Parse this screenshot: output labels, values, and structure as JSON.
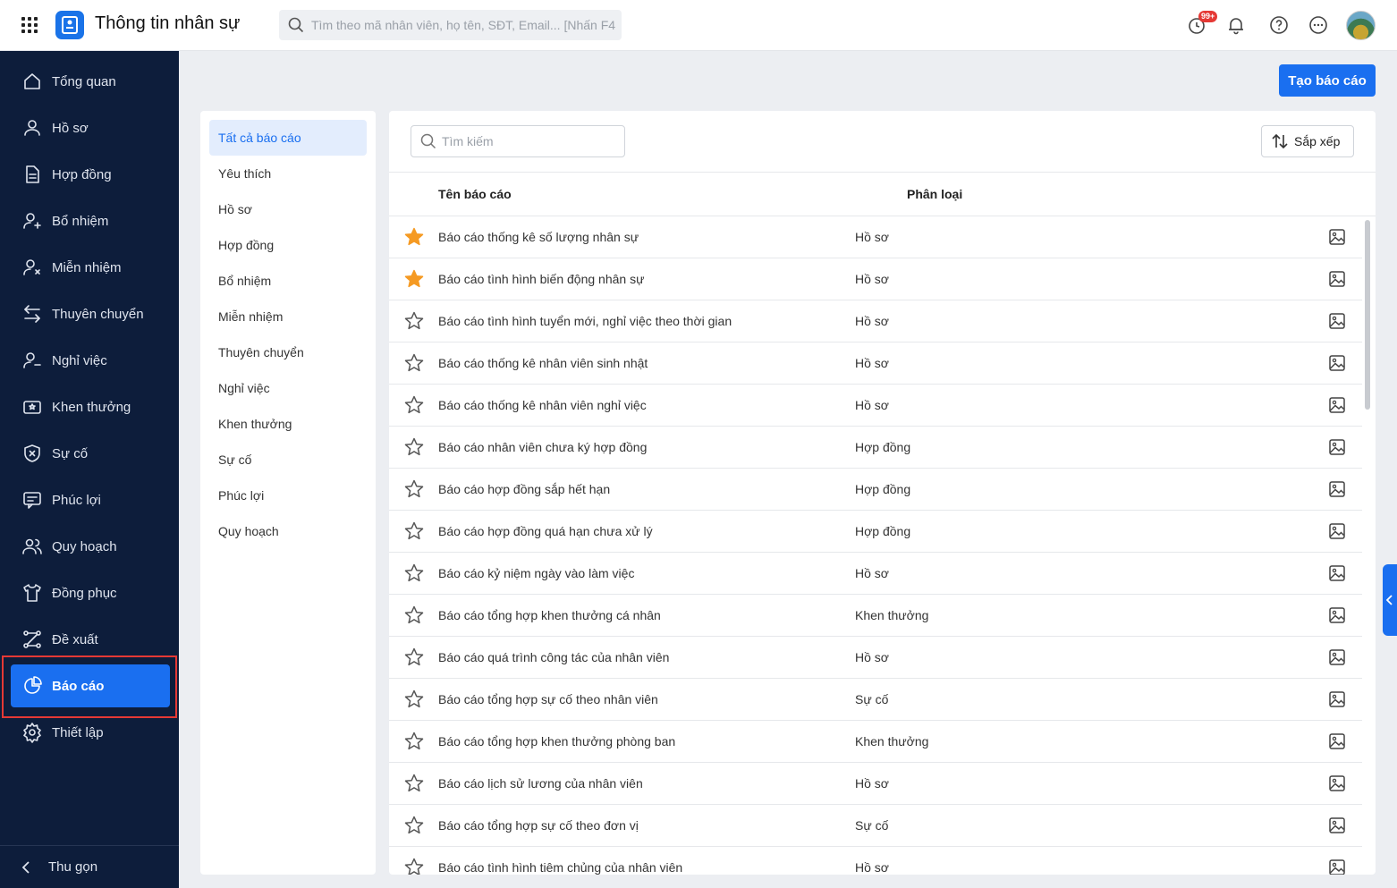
{
  "header": {
    "app_title": "Thông tin nhân sự",
    "search_placeholder": "Tìm theo mã nhân viên, họ tên, SĐT, Email... [Nhấn F4]",
    "notification_badge": "99+"
  },
  "sidebar": {
    "items": [
      {
        "label": "Tổng quan",
        "icon": "home-icon"
      },
      {
        "label": "Hồ sơ",
        "icon": "user-icon"
      },
      {
        "label": "Hợp đồng",
        "icon": "document-icon"
      },
      {
        "label": "Bổ nhiệm",
        "icon": "user-plus-icon"
      },
      {
        "label": "Miễn nhiệm",
        "icon": "user-x-icon"
      },
      {
        "label": "Thuyên chuyển",
        "icon": "transfer-icon"
      },
      {
        "label": "Nghỉ việc",
        "icon": "user-minus-icon"
      },
      {
        "label": "Khen thưởng",
        "icon": "reward-icon"
      },
      {
        "label": "Sự cố",
        "icon": "shield-x-icon"
      },
      {
        "label": "Phúc lợi",
        "icon": "benefit-icon"
      },
      {
        "label": "Quy hoạch",
        "icon": "users-icon"
      },
      {
        "label": "Đồng phục",
        "icon": "shirt-icon"
      },
      {
        "label": "Đề xuất",
        "icon": "proposal-icon"
      },
      {
        "label": "Báo cáo",
        "icon": "pie-chart-icon"
      },
      {
        "label": "Thiết lập",
        "icon": "gear-icon"
      }
    ],
    "active_index": 13,
    "collapse_label": "Thu gọn"
  },
  "toolbar": {
    "create_label": "Tạo báo cáo"
  },
  "categories": {
    "items": [
      "Tất cả báo cáo",
      "Yêu thích",
      "Hồ sơ",
      "Hợp đồng",
      "Bổ nhiệm",
      "Miễn nhiệm",
      "Thuyên chuyển",
      "Nghỉ việc",
      "Khen thưởng",
      "Sự cố",
      "Phúc lợi",
      "Quy hoạch"
    ],
    "active_index": 0
  },
  "list": {
    "search_placeholder": "Tìm kiếm",
    "sort_label": "Sắp xếp",
    "col_name": "Tên báo cáo",
    "col_type": "Phân loại",
    "rows": [
      {
        "name": "Báo cáo thống kê số lượng nhân sự",
        "type": "Hồ sơ",
        "favorite": true
      },
      {
        "name": "Báo cáo tình hình biến động nhân sự",
        "type": "Hồ sơ",
        "favorite": true
      },
      {
        "name": "Báo cáo tình hình tuyển mới, nghỉ việc theo thời gian",
        "type": "Hồ sơ",
        "favorite": false
      },
      {
        "name": "Báo cáo thống kê nhân viên sinh nhật",
        "type": "Hồ sơ",
        "favorite": false
      },
      {
        "name": "Báo cáo thống kê nhân viên nghỉ việc",
        "type": "Hồ sơ",
        "favorite": false
      },
      {
        "name": "Báo cáo nhân viên chưa ký hợp đồng",
        "type": "Hợp đồng",
        "favorite": false
      },
      {
        "name": "Báo cáo hợp đồng sắp hết hạn",
        "type": "Hợp đồng",
        "favorite": false
      },
      {
        "name": "Báo cáo hợp đồng quá hạn chưa xử lý",
        "type": "Hợp đồng",
        "favorite": false
      },
      {
        "name": "Báo cáo kỷ niệm ngày vào làm việc",
        "type": "Hồ sơ",
        "favorite": false
      },
      {
        "name": "Báo cáo tổng hợp khen thưởng cá nhân",
        "type": "Khen thưởng",
        "favorite": false
      },
      {
        "name": "Báo cáo quá trình công tác của nhân viên",
        "type": "Hồ sơ",
        "favorite": false
      },
      {
        "name": "Báo cáo tổng hợp sự cố theo nhân viên",
        "type": "Sự cố",
        "favorite": false
      },
      {
        "name": "Báo cáo tổng hợp khen thưởng phòng ban",
        "type": "Khen thưởng",
        "favorite": false
      },
      {
        "name": "Báo cáo lịch sử lương của nhân viên",
        "type": "Hồ sơ",
        "favorite": false
      },
      {
        "name": "Báo cáo tổng hợp sự cố theo đơn vị",
        "type": "Sự cố",
        "favorite": false
      },
      {
        "name": "Báo cáo tình hình tiêm chủng của nhân viên",
        "type": "Hồ sơ",
        "favorite": false
      }
    ]
  },
  "colors": {
    "primary": "#1a6ff0",
    "sidebar_bg": "#0d1d3b",
    "star_active": "#f59a23",
    "highlight_border": "#e53935"
  }
}
